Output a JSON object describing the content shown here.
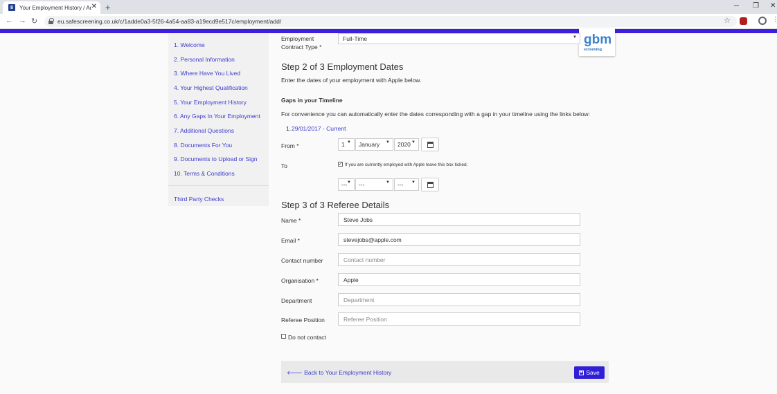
{
  "browser": {
    "tab_title": "Your Employment History / Add",
    "tab_favicon": "8",
    "url": "eu.safescreening.co.uk/c/1adde0a3-5f26-4a54-aa83-a19ecd9e517c/employment/add/"
  },
  "logo": {
    "text": "screening",
    "mark": "gbm"
  },
  "sidebar": {
    "items": [
      "1. Welcome",
      "2. Personal Information",
      "3. Where Have You Lived",
      "4. Your Highest Qualification",
      "5. Your Employment History",
      "6. Any Gaps In Your Employment",
      "7. Additional Questions",
      "8. Documents For You",
      "9. Documents to Upload or Sign",
      "10. Terms & Conditions"
    ],
    "third_party": "Third Party Checks"
  },
  "contract": {
    "label_line1": "Employment",
    "label_line2": "Contract Type *",
    "value": "Full-Time"
  },
  "step2": {
    "heading": "Step 2 of 3 Employment Dates",
    "intro": "Enter the dates of your employment with Apple below.",
    "gaps_heading": "Gaps in your Timeline",
    "gaps_text": "For convenience you can automatically enter the dates corresponding with a gap in your timeline using the links below:",
    "gap_number": "1.",
    "gap_link": "29/01/2017 - Current",
    "from_label": "From *",
    "from_day": "1",
    "from_month": "January",
    "from_year": "2020",
    "to_label": "To",
    "to_checkbox_text": "If you are currently employed with Apple leave this box ticked.",
    "to_checked": true,
    "to_day": "---",
    "to_month": "---",
    "to_year": "---"
  },
  "step3": {
    "heading": "Step 3 of 3 Referee Details",
    "fields": {
      "name": {
        "label": "Name *",
        "value": "Steve Jobs",
        "placeholder": ""
      },
      "email": {
        "label": "Email *",
        "value": "stevejobs@apple.com",
        "placeholder": ""
      },
      "contact": {
        "label": "Contact number",
        "value": "",
        "placeholder": "Contact number"
      },
      "organisation": {
        "label": "Organisation *",
        "value": "Apple",
        "placeholder": ""
      },
      "department": {
        "label": "Department",
        "value": "",
        "placeholder": "Department"
      },
      "position": {
        "label": "Referee Position",
        "value": "",
        "placeholder": "Referee Position"
      }
    },
    "do_not_contact": "Do not contact"
  },
  "footer": {
    "back_label": "Back to Your Employment History",
    "save_label": "Save"
  }
}
